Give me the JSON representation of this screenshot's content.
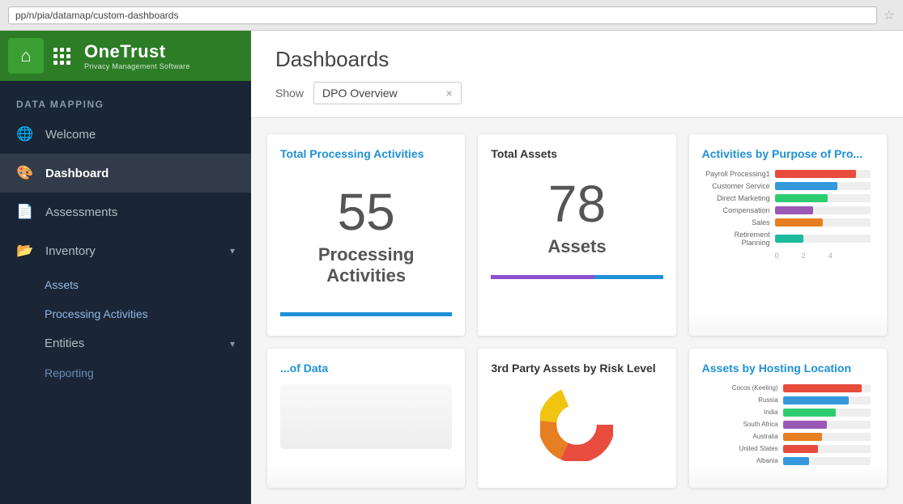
{
  "browser": {
    "url": "pp/n/pia/datamap/custom-dashboards"
  },
  "header": {
    "brand_name": "OneTrust",
    "brand_sub": "Privacy Management Software",
    "logo_icon": "house"
  },
  "sidebar": {
    "section_label": "DATA MAPPING",
    "items": [
      {
        "id": "welcome",
        "label": "Welcome",
        "icon": "globe",
        "active": false
      },
      {
        "id": "dashboard",
        "label": "Dashboard",
        "icon": "palette",
        "active": true
      },
      {
        "id": "assessments",
        "label": "Assessments",
        "icon": "document",
        "active": false,
        "has_chevron": false
      },
      {
        "id": "inventory",
        "label": "Inventory",
        "icon": "folder",
        "active": false,
        "has_chevron": true
      },
      {
        "id": "assets",
        "label": "Assets",
        "sub": true
      },
      {
        "id": "processing-activities",
        "label": "Processing Activities",
        "sub": true
      },
      {
        "id": "entities",
        "label": "Entities",
        "sub": true,
        "has_chevron": true
      },
      {
        "id": "reporting",
        "label": "Reporting",
        "sub": true
      }
    ]
  },
  "page": {
    "title": "Dashboards",
    "show_label": "Show",
    "show_value": "DPO Overview",
    "show_clear": "×"
  },
  "dashboard": {
    "cards": [
      {
        "id": "total-processing",
        "title": "Total Processing Activities",
        "stat_number": "55",
        "stat_label": "Processing\nActivities",
        "bar_color": "blue"
      },
      {
        "id": "total-assets",
        "title": "Total Assets",
        "stat_number": "78",
        "stat_label": "Assets",
        "bar_colors": [
          "purple",
          "blue"
        ]
      },
      {
        "id": "activities-by-purpose",
        "title": "Activities by Purpose of Pro...",
        "bars": [
          {
            "label": "Payroll Processing1",
            "value": 85,
            "color": "#e74c3c"
          },
          {
            "label": "Customer Service",
            "value": 65,
            "color": "#3498db"
          },
          {
            "label": "Direct Marketing",
            "value": 55,
            "color": "#2ecc71"
          },
          {
            "label": "Compensation",
            "value": 40,
            "color": "#9b59b6"
          },
          {
            "label": "Sales",
            "value": 50,
            "color": "#e67e22"
          },
          {
            "label": "Retirement Planning",
            "value": 30,
            "color": "#1abc9c"
          }
        ]
      },
      {
        "id": "of-data",
        "title": "...of Data",
        "partial": true
      },
      {
        "id": "third-party-risk",
        "title": "3rd Party Assets by Risk Level",
        "pie": true
      },
      {
        "id": "hosting-location",
        "title": "Assets by Hosting Location",
        "bars": [
          {
            "label": "Cocos (Keeling)",
            "value": 90,
            "color": "#e74c3c"
          },
          {
            "label": "Russia",
            "value": 75,
            "color": "#3498db"
          },
          {
            "label": "India",
            "value": 60,
            "color": "#2ecc71"
          },
          {
            "label": "South Africa",
            "value": 50,
            "color": "#9b59b6"
          },
          {
            "label": "Australia",
            "value": 45,
            "color": "#e67e22"
          },
          {
            "label": "United States",
            "value": 40,
            "color": "#e74c3c"
          },
          {
            "label": "Albania",
            "value": 30,
            "color": "#3498db"
          }
        ]
      }
    ]
  }
}
